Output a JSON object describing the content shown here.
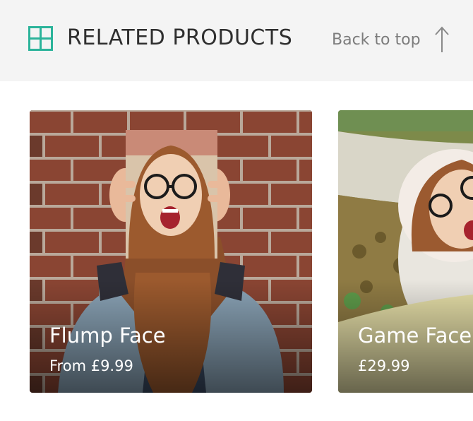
{
  "header": {
    "title": "RELATED PRODUCTS",
    "icon": "grid-icon",
    "back_to_top_label": "Back to top",
    "back_to_top_icon": "arrow-up-icon"
  },
  "colors": {
    "accent": "#2bb39a",
    "header_bg": "#f4f4f4",
    "title_text": "#2f2f2f",
    "muted_text": "#7c7c7c"
  },
  "products": [
    {
      "title": "Flump Face",
      "price": "From £9.99",
      "image": "woman-holding-face-photo-brick-wall"
    },
    {
      "title": "Game Face",
      "price": "£29.99",
      "image": "face-cutout-in-park"
    }
  ]
}
